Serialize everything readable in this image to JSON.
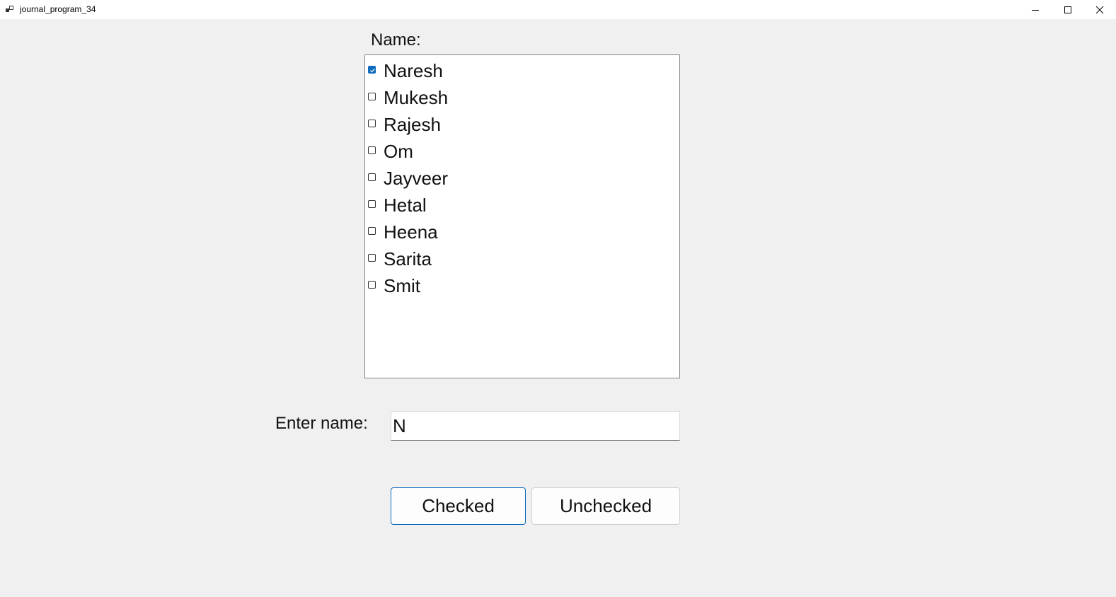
{
  "window": {
    "title": "journal_program_34"
  },
  "form": {
    "name_label": "Name:",
    "items": [
      {
        "label": "Naresh",
        "checked": true
      },
      {
        "label": "Mukesh",
        "checked": false
      },
      {
        "label": "Rajesh",
        "checked": false
      },
      {
        "label": "Om",
        "checked": false
      },
      {
        "label": "Jayveer",
        "checked": false
      },
      {
        "label": "Hetal",
        "checked": false
      },
      {
        "label": "Heena",
        "checked": false
      },
      {
        "label": "Sarita",
        "checked": false
      },
      {
        "label": "Smit",
        "checked": false
      }
    ],
    "enter_label": "Enter name:",
    "enter_value": "N",
    "checked_button": "Checked",
    "unchecked_button": "Unchecked"
  },
  "colors": {
    "accent": "#0f6cbd",
    "window_bg": "#f0f0f0"
  }
}
